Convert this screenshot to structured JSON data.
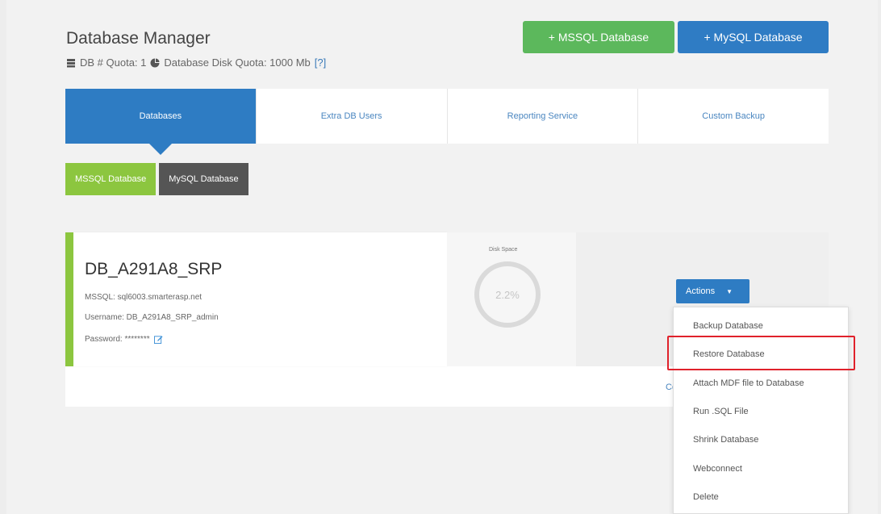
{
  "header": {
    "title": "Database Manager",
    "quota_db": "DB # Quota: 1",
    "quota_disk": "Database Disk Quota: 1000 Mb",
    "quota_help": "[?]",
    "add_mssql_label": "+ MSSQL Database",
    "add_mysql_label": "+ MySQL Database"
  },
  "tabs": [
    {
      "label": "Databases",
      "active": true
    },
    {
      "label": "Extra DB Users",
      "active": false
    },
    {
      "label": "Reporting Service",
      "active": false
    },
    {
      "label": "Custom Backup",
      "active": false
    }
  ],
  "subtabs": [
    {
      "label": "MSSQL Database",
      "active": true
    },
    {
      "label": "MySQL Database",
      "active": false
    }
  ],
  "database": {
    "name": "DB_A291A8_SRP",
    "server": "MSSQL: sql6003.smarterasp.net",
    "username": "Username: DB_A291A8_SRP_admin",
    "password": "Password: ********",
    "disk_label": "Disk Space",
    "disk_usage": "2.2%",
    "link_fragment": "Co"
  },
  "actions": {
    "button_label": "Actions",
    "menu": [
      "Backup Database",
      "Restore Database",
      "Attach MDF file to Database",
      "Run .SQL File",
      "Shrink Database",
      "Webconnect",
      "Delete"
    ],
    "highlighted": "Restore Database"
  },
  "colors": {
    "primary": "#2e7cc3",
    "success": "#5cb85c",
    "mssql_green": "#8cc63f",
    "highlight_red": "#e0212b"
  }
}
